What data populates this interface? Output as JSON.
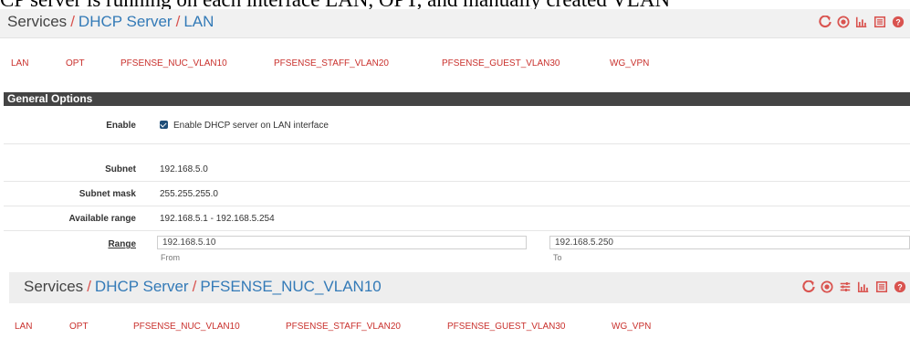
{
  "caption": "CP server is running on each interface LAN, OPT, and manually created VLAN",
  "colors": {
    "accent": "#d9534f",
    "link": "#337ab7",
    "header_bg": "#444444"
  },
  "top_panel": {
    "crumb_root": "Services",
    "crumb_mid": "DHCP Server",
    "crumb_leaf": "LAN",
    "icons": [
      "refresh-icon",
      "stop-circle-icon",
      "chart-icon",
      "list-icon",
      "help-icon"
    ]
  },
  "top_tabs": [
    "LAN",
    "OPT",
    "PFSENSE_NUC_VLAN10",
    "PFSENSE_STAFF_VLAN20",
    "PFSENSE_GUEST_VLAN30",
    "WG_VPN"
  ],
  "section_title": "General Options",
  "form": {
    "enable_label": "Enable",
    "enable_text": "Enable DHCP server on LAN interface",
    "subnet_label": "Subnet",
    "subnet_value": "192.168.5.0",
    "mask_label": "Subnet mask",
    "mask_value": "255.255.255.0",
    "avail_label": "Available range",
    "avail_value": "192.168.5.1 - 192.168.5.254",
    "range_label": "Range",
    "range_from": "192.168.5.10",
    "range_from_caption": "From",
    "range_to": "192.168.5.250",
    "range_to_caption": "To"
  },
  "bottom_panel": {
    "crumb_root": "Services",
    "crumb_mid": "DHCP Server",
    "crumb_leaf": "PFSENSE_NUC_VLAN10",
    "icons": [
      "refresh-icon",
      "stop-circle-icon",
      "sliders-icon",
      "chart-icon",
      "list-icon",
      "help-icon"
    ]
  },
  "bottom_tabs": [
    "LAN",
    "OPT",
    "PFSENSE_NUC_VLAN10",
    "PFSENSE_STAFF_VLAN20",
    "PFSENSE_GUEST_VLAN30",
    "WG_VPN"
  ]
}
